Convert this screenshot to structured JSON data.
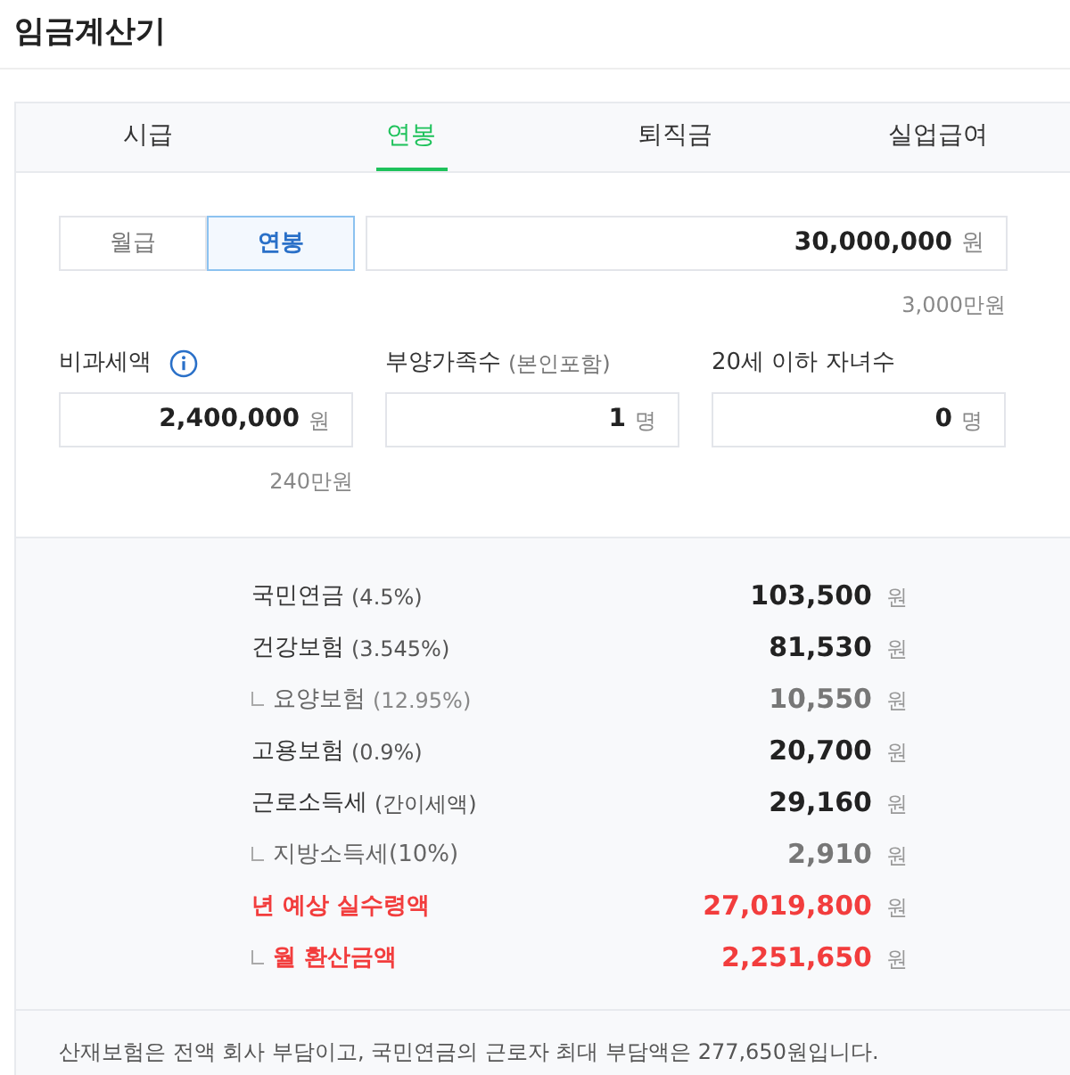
{
  "page_title": "임금계산기",
  "tabs": [
    {
      "label": "시급",
      "selected": false
    },
    {
      "label": "연봉",
      "selected": true
    },
    {
      "label": "퇴직금",
      "selected": false
    },
    {
      "label": "실업급여",
      "selected": false
    }
  ],
  "pay_type": [
    {
      "label": "월급",
      "selected": false
    },
    {
      "label": "연봉",
      "selected": true
    }
  ],
  "salary": {
    "value": "30,000,000",
    "unit": "원",
    "hint": "3,000만원"
  },
  "fields": [
    {
      "kind": "with-info",
      "label": "비과세액",
      "value": "2,400,000",
      "unit": "원",
      "hint": "240만원"
    },
    {
      "kind": "plain",
      "label": "부양가족수",
      "note": "(본인포함)",
      "value": "1",
      "unit": "명"
    },
    {
      "kind": "plain",
      "label": "20세 이하 자녀수",
      "value": "0",
      "unit": "명"
    }
  ],
  "results": [
    {
      "label": "국민연금",
      "rate": "(4.5%)",
      "amount": "103,500",
      "unit": "원",
      "sub": false,
      "highlight": false
    },
    {
      "label": "건강보험",
      "rate": "(3.545%)",
      "amount": "81,530",
      "unit": "원",
      "sub": false,
      "highlight": false
    },
    {
      "label": "요양보험",
      "rate": "(12.95%)",
      "amount": "10,550",
      "unit": "원",
      "sub": true,
      "highlight": false
    },
    {
      "label": "고용보험",
      "rate": "(0.9%)",
      "amount": "20,700",
      "unit": "원",
      "sub": false,
      "highlight": false
    },
    {
      "label": "근로소득세",
      "rate": "(간이세액)",
      "amount": "29,160",
      "unit": "원",
      "sub": false,
      "highlight": false
    },
    {
      "label": "지방소득세(10%)",
      "amount": "2,910",
      "unit": "원",
      "sub": true,
      "highlight": false
    },
    {
      "label": "년 예상 실수령액",
      "amount": "27,019,800",
      "unit": "원",
      "sub": false,
      "highlight": true
    },
    {
      "label": "월 환산금액",
      "amount": "2,251,650",
      "unit": "원",
      "sub": true,
      "highlight": true
    }
  ],
  "footnote": "산재보험은 전액 회사 부담이고, 국민연금의 근로자 최대 부담액은 277,650원입니다."
}
